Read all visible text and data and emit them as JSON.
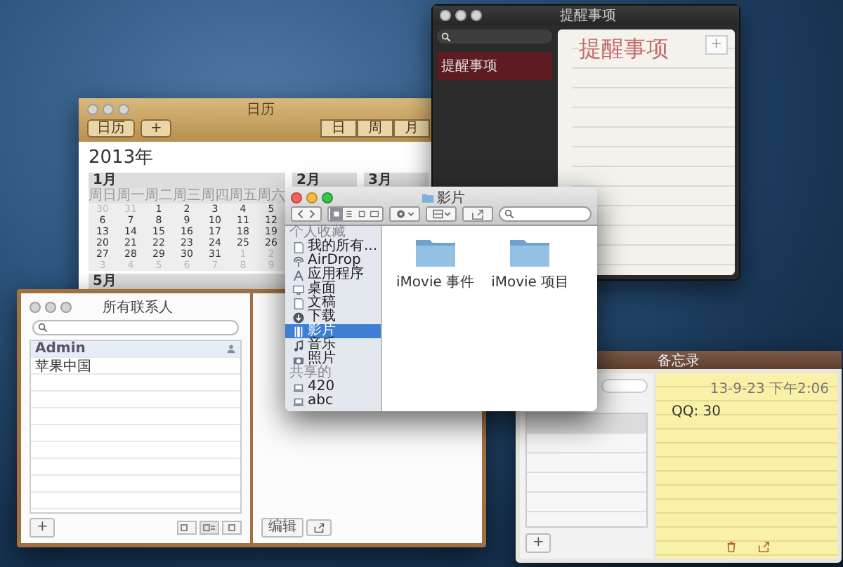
{
  "calendar": {
    "active": false,
    "title": "日历",
    "toolbar": [
      "日历",
      "+"
    ],
    "views": [
      "日",
      "周",
      "月"
    ],
    "year": "2013年",
    "months": [
      {
        "title": "1月",
        "weekdays": [
          "周日",
          "周一",
          "周二",
          "周三",
          "周四",
          "周五",
          "周六"
        ],
        "days": [
          {
            "t": "30",
            "dim": true
          },
          {
            "t": "31",
            "dim": true
          },
          {
            "t": "1",
            "dim": false
          },
          {
            "t": "2",
            "dim": false
          },
          {
            "t": "3",
            "dim": false
          },
          {
            "t": "4",
            "dim": false
          },
          {
            "t": "5",
            "dim": false
          },
          {
            "t": "6",
            "dim": false
          },
          {
            "t": "7",
            "dim": false
          },
          {
            "t": "8",
            "dim": false
          },
          {
            "t": "9",
            "dim": false
          },
          {
            "t": "10",
            "dim": false
          },
          {
            "t": "11",
            "dim": false
          },
          {
            "t": "12",
            "dim": false
          },
          {
            "t": "13",
            "dim": false
          },
          {
            "t": "14",
            "dim": false
          },
          {
            "t": "15",
            "dim": false
          },
          {
            "t": "16",
            "dim": false
          },
          {
            "t": "17",
            "dim": false
          },
          {
            "t": "18",
            "dim": false
          },
          {
            "t": "19",
            "dim": false
          },
          {
            "t": "20",
            "dim": false
          },
          {
            "t": "21",
            "dim": false
          },
          {
            "t": "22",
            "dim": false
          },
          {
            "t": "23",
            "dim": false
          },
          {
            "t": "24",
            "dim": false
          },
          {
            "t": "25",
            "dim": false
          },
          {
            "t": "26",
            "dim": false
          },
          {
            "t": "27",
            "dim": false
          },
          {
            "t": "28",
            "dim": false
          },
          {
            "t": "29",
            "dim": false
          },
          {
            "t": "30",
            "dim": false
          },
          {
            "t": "31",
            "dim": false
          },
          {
            "t": "1",
            "dim": true
          },
          {
            "t": "2",
            "dim": true
          },
          {
            "t": "3",
            "dim": true
          },
          {
            "t": "4",
            "dim": true
          },
          {
            "t": "5",
            "dim": true
          },
          {
            "t": "6",
            "dim": true
          },
          {
            "t": "7",
            "dim": true
          },
          {
            "t": "8",
            "dim": true
          },
          {
            "t": "9",
            "dim": true
          }
        ]
      },
      {
        "title": "2月"
      },
      {
        "title": "3月"
      },
      {
        "title": "5月"
      }
    ]
  },
  "reminders": {
    "active": false,
    "title": "提醒事项",
    "lists": [
      {
        "label": "提醒事项",
        "selected": true
      }
    ],
    "heading": "提醒事项",
    "add": "+"
  },
  "notes": {
    "title": "备忘录",
    "rows": [
      {
        "selected": true
      }
    ],
    "add": "+",
    "date": "13-9-23 下午2:06",
    "body": "QQ: 30"
  },
  "contacts": {
    "active": false,
    "title": "所有联系人",
    "people": [
      {
        "name": "Admin",
        "selected": true,
        "me": true
      },
      {
        "name": "苹果中国",
        "selected": false,
        "me": false
      }
    ],
    "add": "+",
    "edit": "编辑"
  },
  "finder": {
    "active": true,
    "title": "影片",
    "sections": [
      {
        "header": "个人收藏",
        "items": [
          {
            "label": "我的所有...",
            "selected": false
          },
          {
            "label": "AirDrop",
            "selected": false
          },
          {
            "label": "应用程序",
            "selected": false
          },
          {
            "label": "桌面",
            "selected": false
          },
          {
            "label": "文稿",
            "selected": false
          },
          {
            "label": "下载",
            "selected": false
          },
          {
            "label": "影片",
            "selected": true
          },
          {
            "label": "音乐",
            "selected": false
          },
          {
            "label": "照片",
            "selected": false
          }
        ]
      },
      {
        "header": "共享的",
        "items": [
          {
            "label": "420",
            "selected": false
          },
          {
            "label": "abc",
            "selected": false
          }
        ]
      }
    ],
    "folders": [
      "iMovie 事件",
      "iMovie 项目"
    ]
  }
}
